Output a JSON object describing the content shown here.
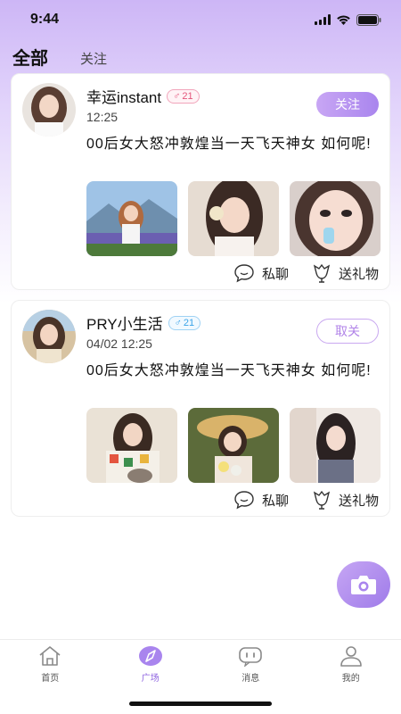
{
  "status_bar": {
    "time": "9:44"
  },
  "header": {
    "tabs": [
      {
        "label": "全部",
        "active": true
      },
      {
        "label": "关注",
        "active": false
      }
    ]
  },
  "posts": [
    {
      "username": "幸运instant",
      "gender": "female",
      "gender_symbol": "♂",
      "age": "21",
      "time": "12:25",
      "follow_label": "关注",
      "text": "00后女大怒冲敦煌当一天飞天神女 如何呢!",
      "actions": {
        "chat": "私聊",
        "gift": "送礼物"
      }
    },
    {
      "username": "PRY小生活",
      "gender": "male",
      "gender_symbol": "♂",
      "age": "21",
      "time": "04/02 12:25",
      "follow_label": "取关",
      "text": "00后女大怒冲敦煌当一天飞天神女 如何呢!",
      "actions": {
        "chat": "私聊",
        "gift": "送礼物"
      }
    }
  ],
  "bottom_nav": [
    {
      "label": "首页",
      "icon": "home-icon",
      "active": false
    },
    {
      "label": "广场",
      "icon": "compass-icon",
      "active": true
    },
    {
      "label": "消息",
      "icon": "message-icon",
      "active": false
    },
    {
      "label": "我的",
      "icon": "profile-icon",
      "active": false
    }
  ],
  "colors": {
    "accent": "#a985ee",
    "female_badge": "#e4547a",
    "male_badge": "#3aa3e8"
  }
}
